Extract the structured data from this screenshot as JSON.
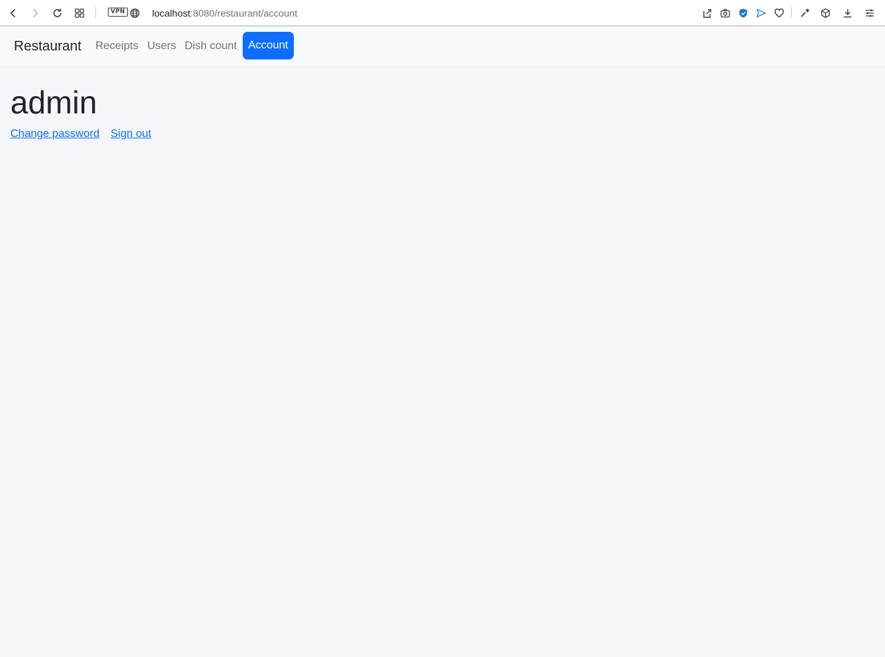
{
  "browser": {
    "url_host": "localhost",
    "url_rest": ":8080/restaurant/account",
    "vpn_label": "VPN",
    "icons": [
      "back-icon",
      "forward-icon",
      "reload-icon",
      "tabs-grid-icon",
      "globe-icon",
      "share-icon",
      "camera-icon",
      "shield-icon",
      "send-icon",
      "heart-icon",
      "eyedropper-icon",
      "cube-icon",
      "download-icon",
      "menu-sliders-icon"
    ]
  },
  "navbar": {
    "brand": "Restaurant",
    "links": [
      {
        "label": "Receipts",
        "active": false
      },
      {
        "label": "Users",
        "active": false
      },
      {
        "label": "Dish count",
        "active": false
      },
      {
        "label": "Account",
        "active": true
      }
    ],
    "active_color": "#0d6efd"
  },
  "main": {
    "title": "admin",
    "links": [
      {
        "label": "Change password"
      },
      {
        "label": "Sign out"
      }
    ]
  }
}
